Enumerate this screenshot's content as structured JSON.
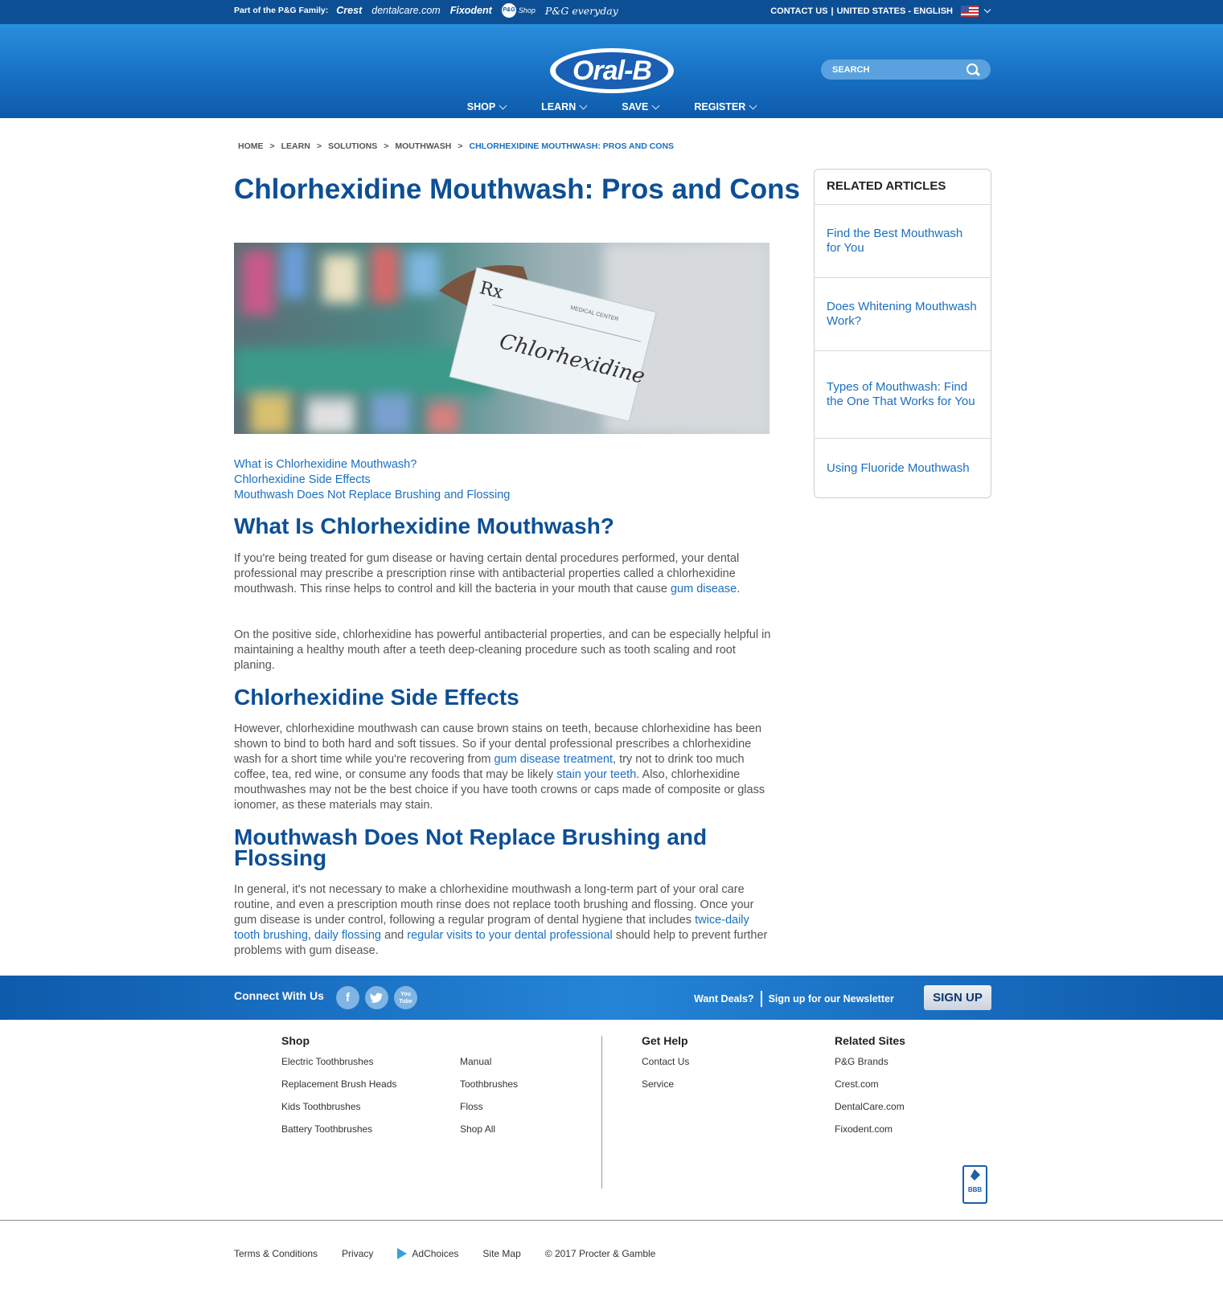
{
  "topbar": {
    "family_label": "Part of the P&G Family:",
    "brands": [
      "Crest",
      "dentalcare.com",
      "Fixodent",
      "Shop",
      "P&G everyday"
    ],
    "pg_badge": "P&G",
    "contact": "CONTACT US",
    "region": "UNITED STATES - ENGLISH",
    "separator": "|"
  },
  "header": {
    "logo_text": "Oral-B",
    "search_placeholder": "SEARCH",
    "nav": [
      "SHOP",
      "LEARN",
      "SAVE",
      "REGISTER"
    ]
  },
  "breadcrumb": [
    "HOME",
    "LEARN",
    "SOLUTIONS",
    "MOUTHWASH",
    "CHLORHEXIDINE MOUTHWASH: PROS AND CONS"
  ],
  "breadcrumb_sep": ">",
  "article": {
    "title": "Chlorhexidine Mouthwash: Pros and Cons",
    "hero_rx": "Rx",
    "hero_header": "MEDICAL CENTER",
    "hero_script": "Chlorhexidine",
    "toc": [
      "What is Chlorhexidine Mouthwash?",
      "Chlorhexidine Side Effects",
      "Mouthwash Does Not Replace Brushing and Flossing"
    ],
    "h_what": "What Is Chlorhexidine Mouthwash?",
    "p1a": "If you're being treated for gum disease or having certain dental procedures performed, your dental professional may prescribe a prescription rinse with antibacterial properties called a chlorhexidine mouthwash. This rinse helps to control and kill the bacteria in your mouth that cause ",
    "p1_link": "gum disease",
    "p1b": ".",
    "p2": "On the positive side, chlorhexidine has powerful antibacterial properties, and can be especially helpful in maintaining a healthy mouth after a teeth deep-cleaning procedure such as tooth scaling and root planing.",
    "h_side": "Chlorhexidine Side Effects",
    "p3a": "However, chlorhexidine mouthwash can cause brown stains on teeth, because chlorhexidine has been shown to bind to both hard and soft tissues. So if your dental professional prescribes a chlorhexidine wash for a short time while you're recovering from ",
    "p3_link1": "gum disease treatment",
    "p3b": ", try not to drink too much coffee, tea, red wine, or consume any foods that may be likely ",
    "p3_link2": "stain your teeth",
    "p3c": ". Also, chlorhexidine mouthwashes may not be the best choice if you have tooth crowns or caps made of composite or glass ionomer, as these materials may stain.",
    "h_replace": "Mouthwash Does Not Replace Brushing and Flossing",
    "p4a": "In general, it's not necessary to make a chlorhexidine mouthwash a long-term part of your oral care routine, and even a prescription mouth rinse does not replace tooth brushing and flossing. Once your gum disease is under control, following a regular program of dental hygiene that includes ",
    "p4_link1": "twice-daily tooth brushing",
    "p4b": ", ",
    "p4_link2": "daily flossing",
    "p4c": " and ",
    "p4_link3": "regular visits to your dental professional",
    "p4d": " should help to prevent further problems with gum disease."
  },
  "related": {
    "heading": "RELATED ARTICLES",
    "items": [
      "Find the Best Mouthwash for You",
      "Does Whitening Mouthwash Work?",
      "Types of Mouthwash: Find the One That Works for You",
      "Using Fluoride Mouthwash"
    ]
  },
  "connect": {
    "label": "Connect With Us",
    "facebook": "f",
    "youtube": "You Tube",
    "deals": "Want Deals?",
    "newsletter": "Sign up for our Newsletter",
    "signup": "SIGN UP"
  },
  "footer": {
    "shop_heading": "Shop",
    "shop_col1": [
      "Electric Toothbrushes",
      "Replacement Brush Heads",
      "Kids Toothbrushes",
      "Battery Toothbrushes"
    ],
    "shop_col2": [
      "Manual",
      "Toothbrushes",
      "Floss",
      "Shop All"
    ],
    "help_heading": "Get Help",
    "help": [
      "Contact Us",
      "Service"
    ],
    "related_heading": "Related Sites",
    "related_sites": [
      "P&G Brands",
      "Crest.com",
      "DentalCare.com",
      "Fixodent.com"
    ],
    "bbb": "BBB",
    "legal": [
      "Terms & Conditions",
      "Privacy",
      "AdChoices",
      "Site Map",
      "© 2017 Procter & Gamble"
    ]
  }
}
